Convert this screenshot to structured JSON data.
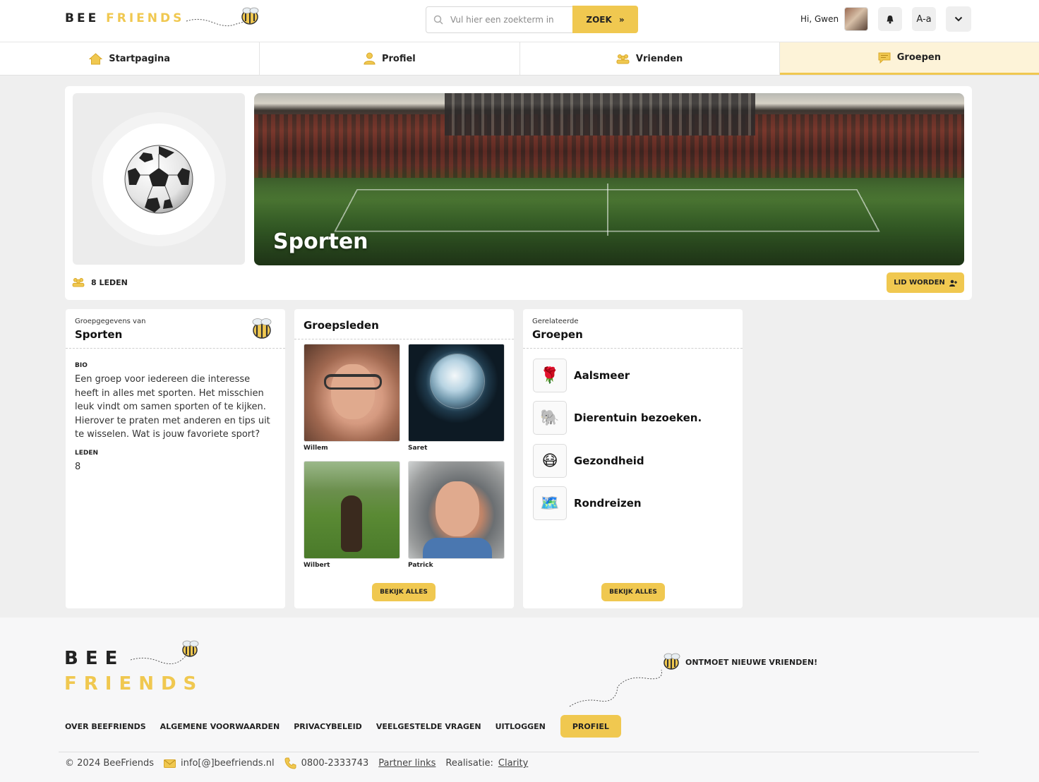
{
  "header": {
    "logo_bee": "BEE",
    "logo_friends": "FRIENDS",
    "search_placeholder": "Vul hier een zoekterm in",
    "search_button": "ZOEK",
    "greeting": "Hi, Gwen",
    "font_toggle": "A-a",
    "icons": [
      "search-icon",
      "bell-icon",
      "chevron-down-icon",
      "double-chevron-right-icon"
    ]
  },
  "nav": {
    "items": [
      {
        "label": "Startpagina",
        "icon": "home-icon",
        "active": false
      },
      {
        "label": "Profiel",
        "icon": "user-icon",
        "active": false
      },
      {
        "label": "Vrienden",
        "icon": "friends-icon",
        "active": false
      },
      {
        "label": "Groepen",
        "icon": "chat-icon",
        "active": true
      }
    ]
  },
  "group": {
    "name": "Sporten",
    "emoji": "⚽",
    "members_label": "8 LEDEN",
    "join_button": "LID WORDEN"
  },
  "details_panel": {
    "kicker": "Groepgegevens van",
    "title": "Sporten",
    "bio_label": "BIO",
    "bio_text": "Een groep voor iedereen die interesse heeft in alles met sporten. Het misschien leuk vindt om samen sporten of te kijken. Hierover te praten met anderen en tips uit te wisselen. Wat is jouw favoriete sport?",
    "members_label": "LEDEN",
    "members_value": "8"
  },
  "members_panel": {
    "title": "Groepsleden",
    "members": [
      {
        "name": "Willem"
      },
      {
        "name": "Saret"
      },
      {
        "name": "Wilbert"
      },
      {
        "name": "Patrick"
      }
    ],
    "button": "BEKIJK ALLES"
  },
  "related_panel": {
    "kicker": "Gerelateerde",
    "title": "Groepen",
    "items": [
      {
        "label": "Aalsmeer",
        "emoji": "🌹"
      },
      {
        "label": "Dierentuin bezoeken.",
        "emoji": "🐘"
      },
      {
        "label": "Gezondheid",
        "emoji": "😷"
      },
      {
        "label": "Rondreizen",
        "emoji": "🗺️"
      }
    ],
    "button": "BEKIJK ALLES"
  },
  "footer": {
    "logo_bee": "BEE",
    "logo_friends": "FRIENDS",
    "tagline": "ONTMOET NIEUWE VRIENDEN!",
    "links": [
      "OVER BEEFRIENDS",
      "ALGEMENE VOORWAARDEN",
      "PRIVACYBELEID",
      "VEELGESTELDE VRAGEN",
      "UITLOGGEN"
    ],
    "profile_button": "PROFIEL",
    "copyright": "© 2024 BeeFriends",
    "email": "info[@]beefriends.nl",
    "phone": "0800-2333743",
    "partner_links": "Partner links",
    "realisatie_label": "Realisatie:",
    "realisatie_link": "Clarity"
  },
  "colors": {
    "accent": "#f0c850",
    "nav_active_bg": "#fdf3d8",
    "page_bg": "#efefef"
  }
}
